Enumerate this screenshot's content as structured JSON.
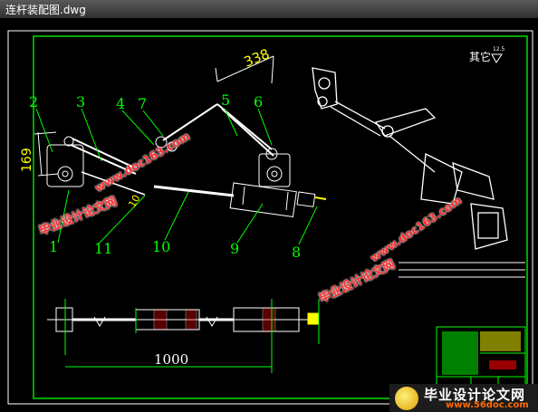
{
  "window": {
    "title": "连杆装配图.dwg"
  },
  "drawing": {
    "roughness_label": "其它",
    "roughness_value": "12.5",
    "dimensions": {
      "d338": "338",
      "d169": "169",
      "d10": "10",
      "d1000": "1000"
    },
    "part_numbers": [
      "1",
      "2",
      "3",
      "4",
      "5",
      "6",
      "7",
      "8",
      "9",
      "10",
      "11"
    ]
  },
  "watermarks": {
    "cn_text": "毕业设计论文网",
    "url_text": "www.doc163.com"
  },
  "logo": {
    "cn": "毕业设计论文网",
    "url": "www.56doc.com"
  },
  "colors": {
    "bg": "#000000",
    "frame": "#ffffff",
    "outline": "#00ff00",
    "dim": "#ffff00",
    "cyan": "#00ffff",
    "red": "#ff0000"
  }
}
